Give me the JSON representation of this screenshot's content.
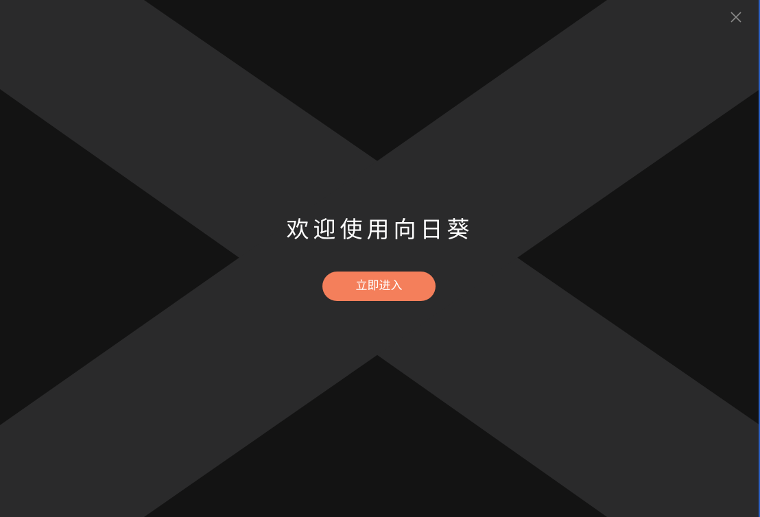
{
  "window": {
    "close_icon": "close-icon"
  },
  "welcome": {
    "title": "欢迎使用向日葵",
    "enter_label": "立即进入"
  },
  "colors": {
    "background": "#131313",
    "x_band": "#2a2a2b",
    "accent": "#f47f5b",
    "text": "#ffffff"
  }
}
